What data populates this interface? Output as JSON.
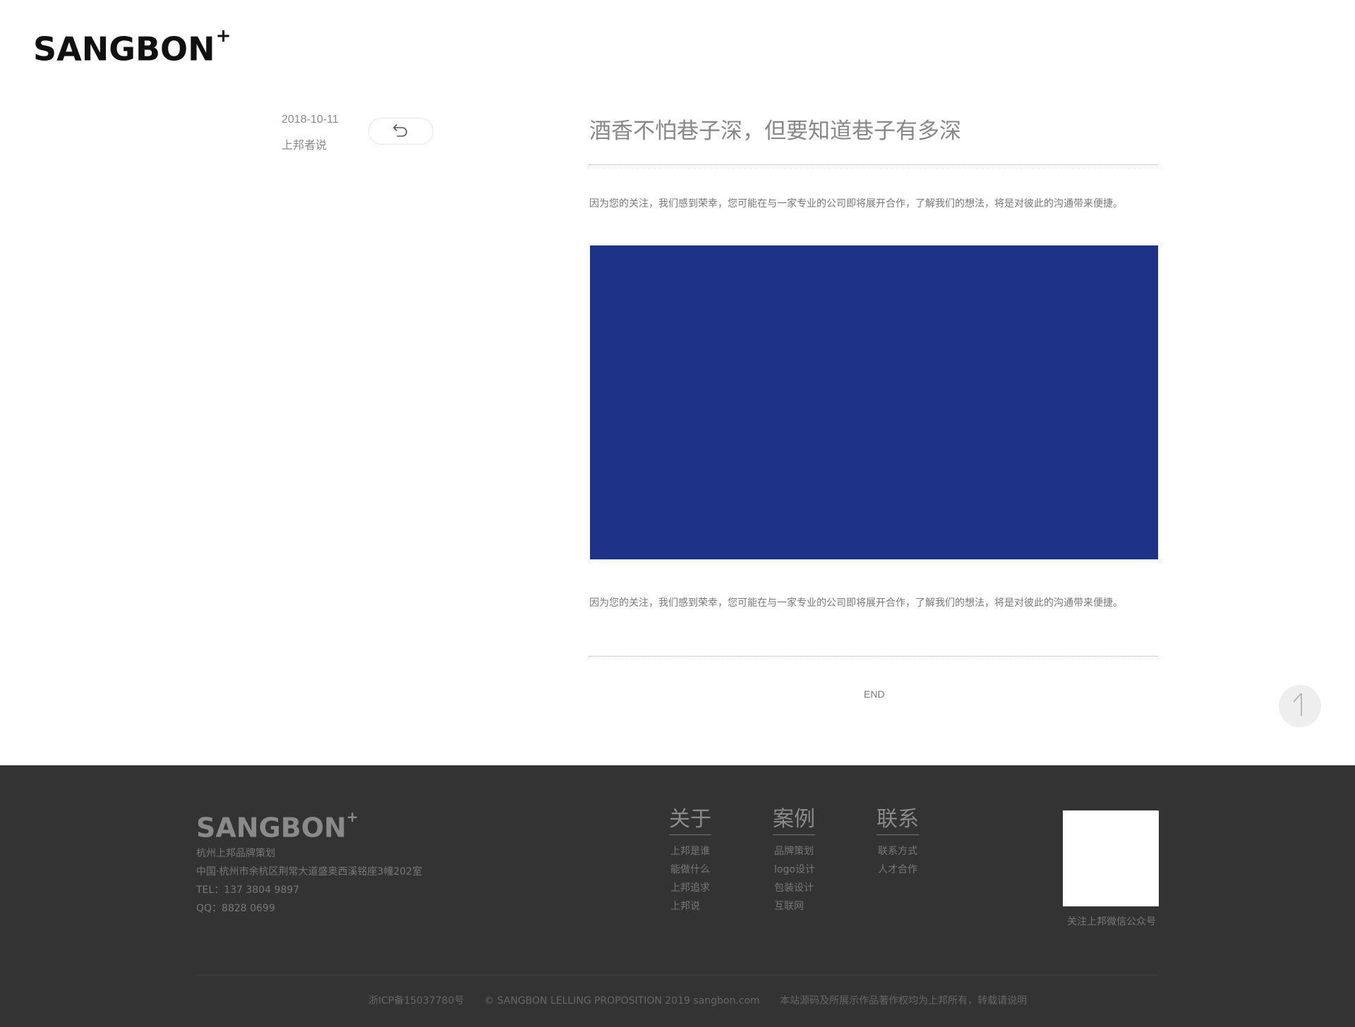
{
  "header": {
    "logo_text": "SANGBON",
    "logo_mark": "+"
  },
  "article": {
    "date": "2018-10-11",
    "category": "上邦者说",
    "title": "酒香不怕巷子深，但要知道巷子有多深",
    "paragraph1": "因为您的关注，我们感到荣幸，您可能在与一家专业的公司即将展开合作，了解我们的想法，将是对彼此的沟通带来便捷。",
    "hero_color": "#1c3388",
    "paragraph2": "因为您的关注，我们感到荣幸，您可能在与一家专业的公司即将展开合作，了解我们的想法，将是对彼此的沟通带来便捷。",
    "end_label": "END"
  },
  "footer": {
    "logo_text": "SANGBON",
    "logo_mark": "+",
    "company": "杭州上邦品牌策划",
    "address": "中国·杭州市余杭区荆常大道盛奥西溪铭座3幢202室",
    "tel": "TEL：137 3804 9897",
    "qq": "QQ：8828 0699",
    "columns": [
      {
        "title": "关于",
        "items": [
          "上邦是谁",
          "能做什么",
          "上邦追求",
          "上邦说"
        ]
      },
      {
        "title": "案例",
        "items": [
          "品牌策划",
          "logo设计",
          "包装设计",
          "互联网"
        ]
      },
      {
        "title": "联系",
        "items": [
          "联系方式",
          "人才合作"
        ]
      }
    ],
    "qr_caption": "关注上邦微信公众号",
    "icp": "浙ICP备15037780号",
    "copyright": "© SANGBON LELLING PROPOSITION 2019  sangbon.com",
    "rights": "本站源码及所展示作品著作权均为上邦所有，转载请说明"
  }
}
